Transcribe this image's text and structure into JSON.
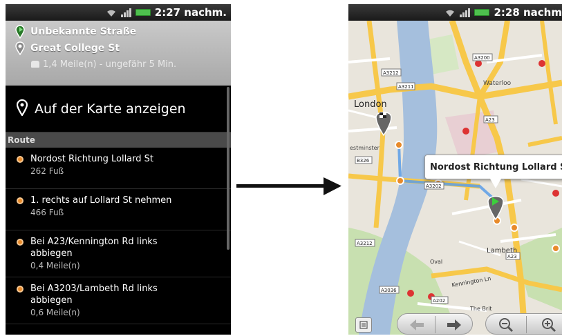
{
  "left": {
    "status": {
      "time": "2:27 nachm."
    },
    "header": {
      "start": "Unbekannte Straße",
      "destination": "Great College St",
      "summary": "1,4 Meile(n) - ungefähr 5 Min."
    },
    "show_on_map": "Auf der Karte anzeigen",
    "route_section": "Route",
    "route_steps": [
      {
        "text": "Nordost Richtung Lollard St",
        "distance": "262 Fuß"
      },
      {
        "text": "1. rechts auf Lollard St nehmen",
        "distance": "466 Fuß"
      },
      {
        "text": "Bei A23/Kennington Rd links abbiegen",
        "distance": "0,4 Meile(n)"
      },
      {
        "text": "Bei A3203/Lambeth Rd links abbiegen",
        "distance": "0,6 Meile(n)"
      }
    ]
  },
  "right": {
    "status": {
      "time": "2:28 nachm"
    },
    "callout": "Nordost Richtung Lollard St",
    "map_labels": {
      "london": "London",
      "waterloo": "Waterloo",
      "lambeth": "Lambeth",
      "westminster": "estminster",
      "road_a3212": "A3212",
      "road_a3211": "A3211",
      "road_a3200": "A3200",
      "road_a23": "A23",
      "road_b326": "B326",
      "road_a3202": "A3202",
      "road_a3036": "A3036",
      "road_a202": "A202",
      "kennington": "Kennington Ln",
      "the_brit": "The Brit",
      "oval": "Oval"
    }
  },
  "colors": {
    "route": "#5a9ee8",
    "river": "#a5bfdd",
    "major_road": "#f7c84a",
    "park": "#c8e0b0",
    "step_dot": "#e88a2a"
  }
}
